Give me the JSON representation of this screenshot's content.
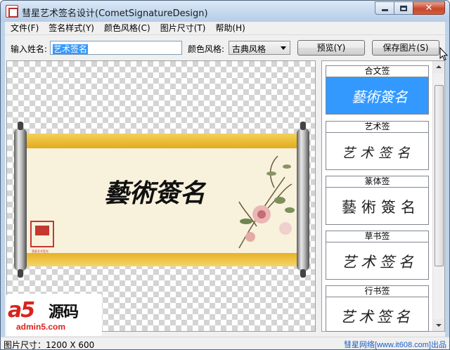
{
  "window": {
    "title": "彗星艺术签名设计(CometSignatureDesign)",
    "close_symbol": "✕"
  },
  "menu": [
    {
      "label": "文件(F)"
    },
    {
      "label": "签名样式(Y)"
    },
    {
      "label": "颜色风格(C)"
    },
    {
      "label": "图片尺寸(T)"
    },
    {
      "label": "帮助(H)"
    }
  ],
  "toolbar": {
    "name_label": "输入姓名:",
    "name_value": "艺术签名",
    "color_label": "颜色风格:",
    "color_value": "古典风格",
    "preview_label": "预览(Y)",
    "save_label": "保存图片(S)"
  },
  "canvas": {
    "signature_text": "藝術簽名",
    "seal_text": "彗星艺术签名"
  },
  "styles": [
    {
      "label": "合文签",
      "sample": "藝術簽名",
      "selected": true
    },
    {
      "label": "艺术签",
      "sample": "艺术签名",
      "selected": false
    },
    {
      "label": "篆体签",
      "sample": "藝術簽名",
      "selected": false
    },
    {
      "label": "草书签",
      "sample": "艺术签名",
      "selected": false
    },
    {
      "label": "行书签",
      "sample": "艺术签名",
      "selected": false
    }
  ],
  "status": {
    "size_text": "图片尺寸：1200 X 600",
    "credit": "彗星网络[www.it608.com]出品"
  },
  "watermark": {
    "brand": "a5",
    "brand_cn": "源码",
    "url": "admin5.com"
  },
  "colors": {
    "selected_card": "#3399ff",
    "scroll_gold": "#e8b820",
    "credit_link": "#1a5ec0"
  }
}
